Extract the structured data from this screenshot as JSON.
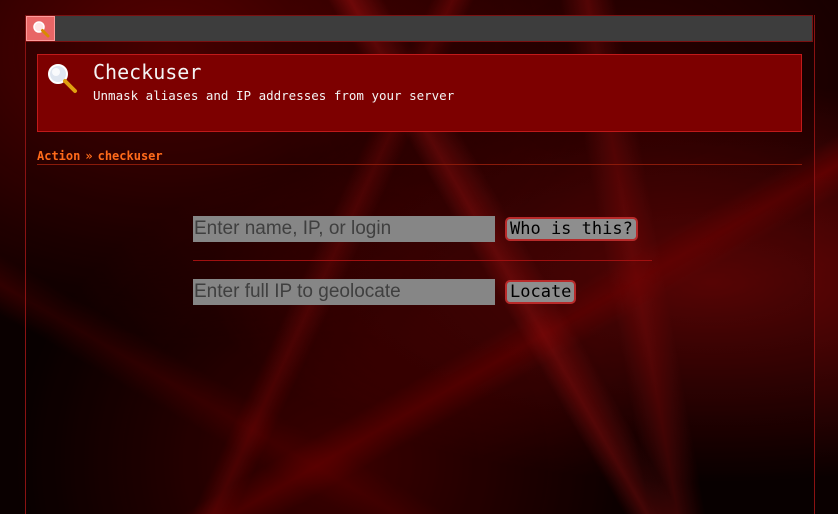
{
  "header": {
    "title": "Checkuser",
    "subtitle": "Unmask aliases and IP addresses from your server"
  },
  "breadcrumb": {
    "parent": "Action",
    "separator": "»",
    "current": "checkuser"
  },
  "lookup": {
    "placeholder": "Enter name, IP, or login",
    "value": "",
    "button_label": "Who is this?"
  },
  "geolocate": {
    "placeholder": "Enter full IP to geolocate",
    "value": "",
    "button_label": "Locate"
  },
  "icons": {
    "topbar": "search-icon",
    "header": "magnifier-icon"
  },
  "colors": {
    "accent": "#ff6a1a",
    "header_bg": "#7d0000",
    "border": "#c01a1a",
    "topbar_button": "#e86666"
  }
}
